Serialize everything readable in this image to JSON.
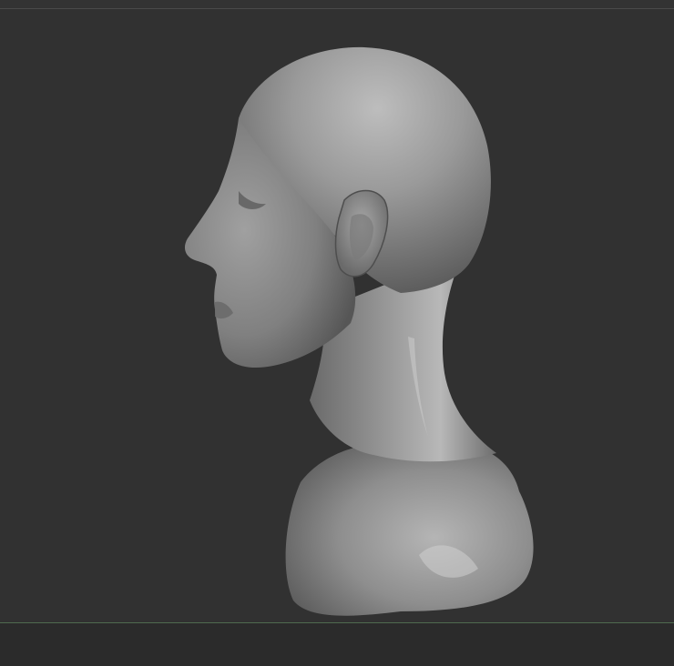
{
  "app": {
    "viewport_background": "#313131",
    "frame_background": "#2b2b2b",
    "frame_line_color": "#4a4a4a",
    "ground_line_color": "#4f6b4f"
  },
  "model": {
    "name": "sculpted-head-bust",
    "material_color": "#8c8c8c",
    "view": "left-profile"
  }
}
